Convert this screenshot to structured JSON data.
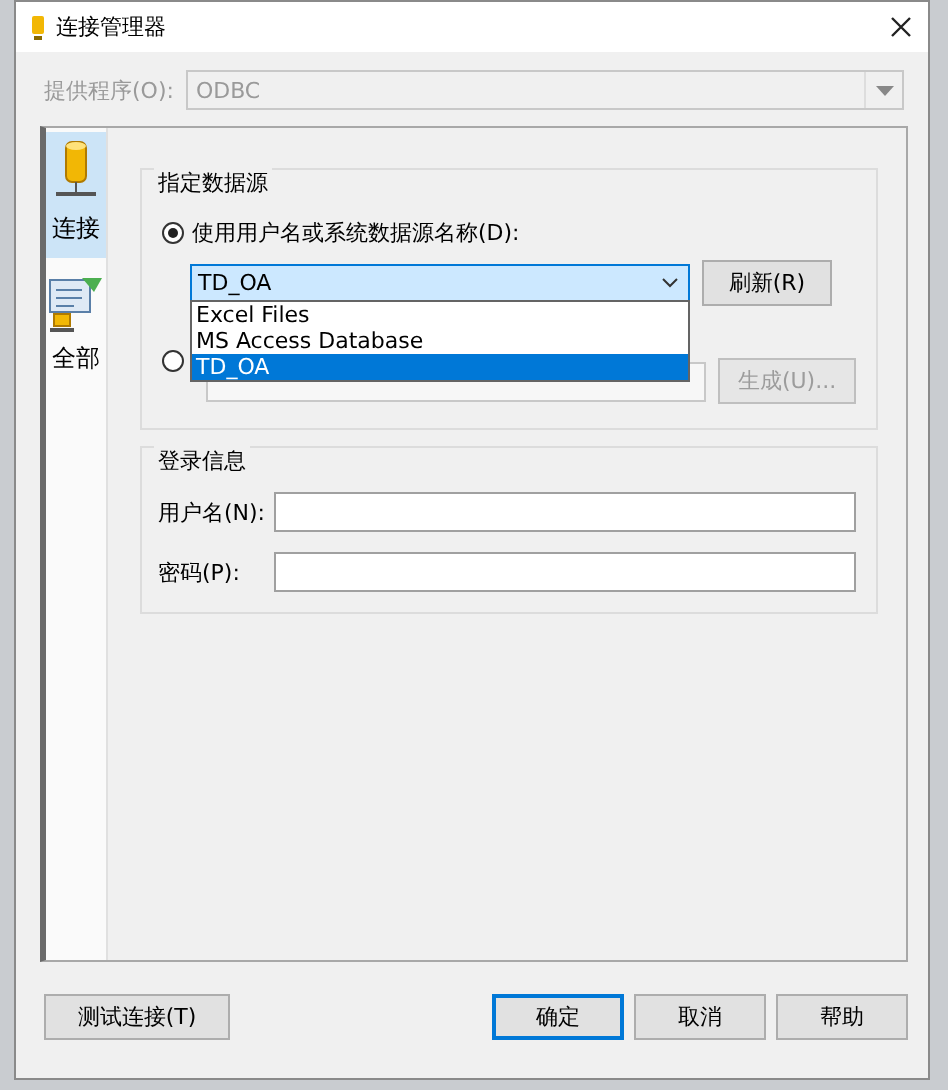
{
  "window": {
    "title": "连接管理器"
  },
  "provider": {
    "label": "提供程序(O):",
    "value": "ODBC",
    "disabled": true
  },
  "nav": [
    {
      "kind": "connection",
      "label": "连接",
      "selected": true
    },
    {
      "kind": "all",
      "label": "全部",
      "selected": false
    }
  ],
  "data_source": {
    "title": "指定数据源",
    "options": [
      {
        "label": "使用用户名或系统数据源名称(D):",
        "selected": true
      },
      {
        "selected": false
      }
    ],
    "dsn": {
      "value": "TD_OA",
      "expanded": true,
      "items": [
        {
          "label": "Excel Files",
          "selected": false
        },
        {
          "label": "MS Access Database",
          "selected": false
        },
        {
          "label": "TD_OA",
          "selected": true
        }
      ]
    },
    "refresh": {
      "label": "刷新(R)",
      "disabled": false
    },
    "build": {
      "label": "生成(U)...",
      "disabled": true
    }
  },
  "login": {
    "title": "登录信息",
    "fields": [
      {
        "label": "用户名(N):"
      },
      {
        "label": "密码(P):"
      }
    ]
  },
  "test_button": {
    "label": "测试连接(T)"
  },
  "buttons": [
    {
      "label": "确定",
      "default": true
    },
    {
      "label": "取消",
      "default": false
    },
    {
      "label": "帮助",
      "default": false
    }
  ]
}
